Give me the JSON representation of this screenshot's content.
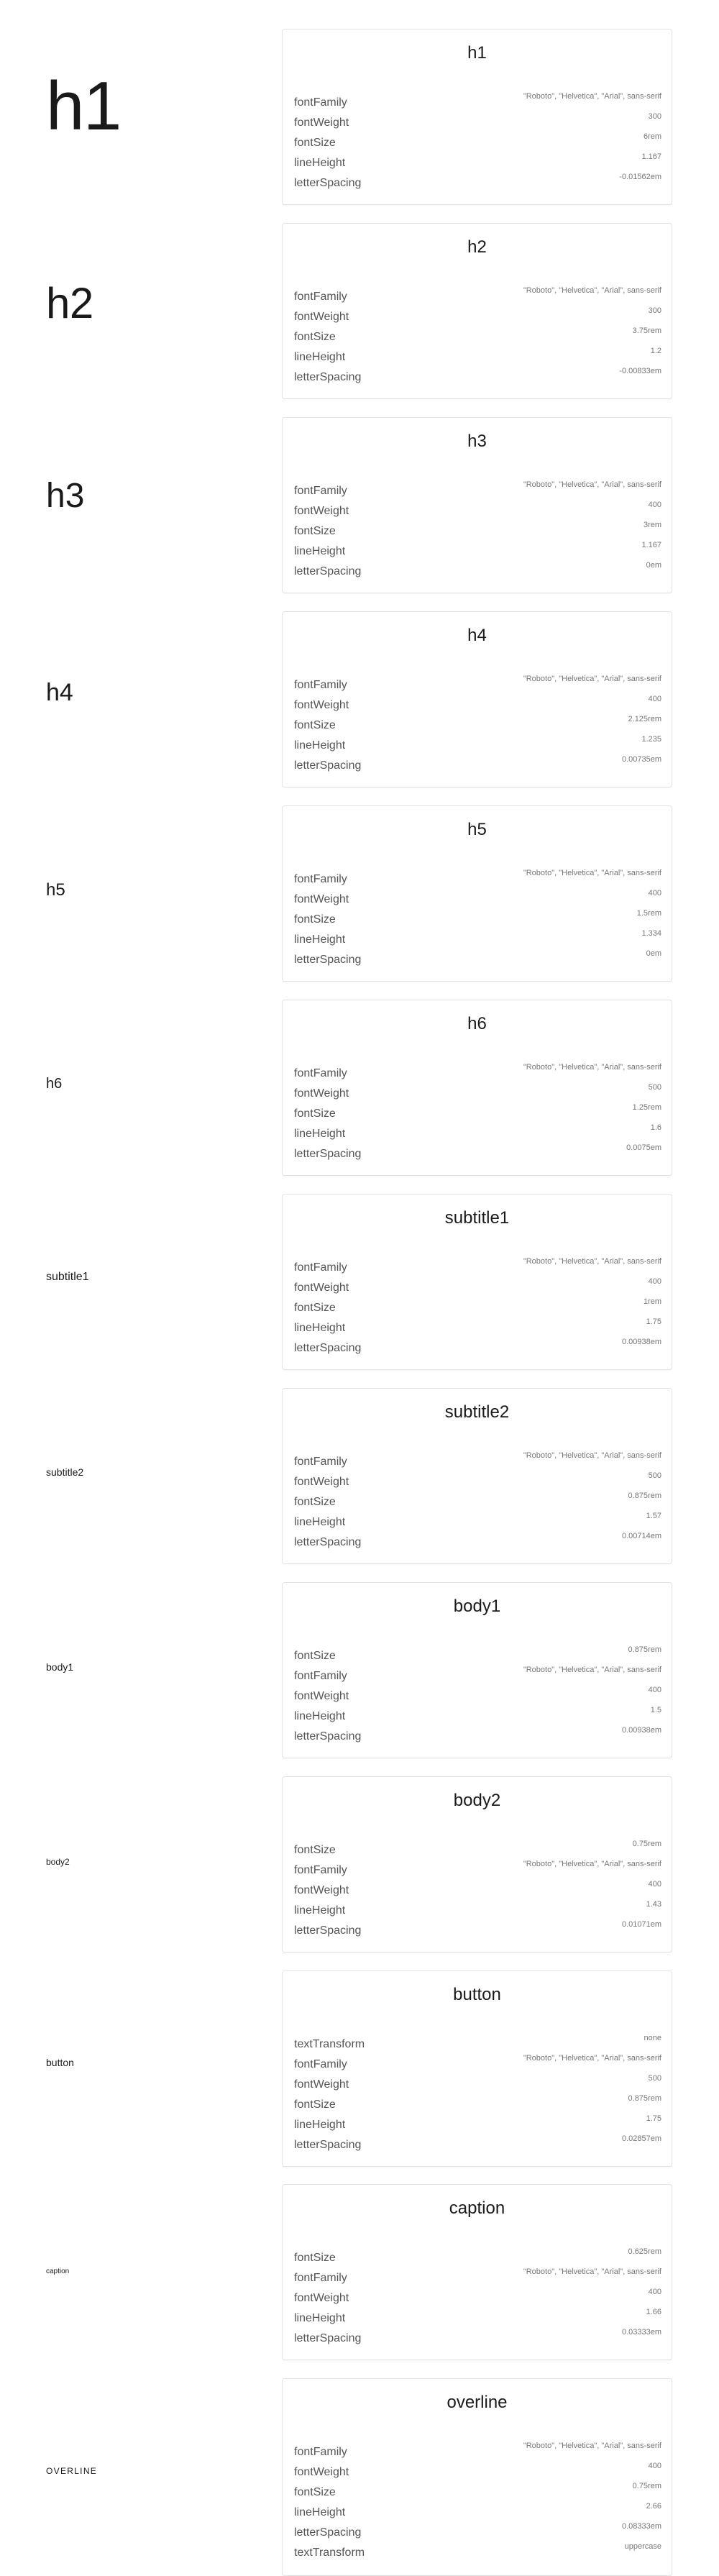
{
  "variants": [
    {
      "key": "h1",
      "sample": "h1",
      "title": "h1",
      "props": [
        {
          "k": "fontFamily",
          "v": "\"Roboto\", \"Helvetica\", \"Arial\", sans-serif"
        },
        {
          "k": "fontWeight",
          "v": "300"
        },
        {
          "k": "fontSize",
          "v": "6rem"
        },
        {
          "k": "lineHeight",
          "v": "1.167"
        },
        {
          "k": "letterSpacing",
          "v": "-0.01562em"
        }
      ]
    },
    {
      "key": "h2",
      "sample": "h2",
      "title": "h2",
      "props": [
        {
          "k": "fontFamily",
          "v": "\"Roboto\", \"Helvetica\", \"Arial\", sans-serif"
        },
        {
          "k": "fontWeight",
          "v": "300"
        },
        {
          "k": "fontSize",
          "v": "3.75rem"
        },
        {
          "k": "lineHeight",
          "v": "1.2"
        },
        {
          "k": "letterSpacing",
          "v": "-0.00833em"
        }
      ]
    },
    {
      "key": "h3",
      "sample": "h3",
      "title": "h3",
      "props": [
        {
          "k": "fontFamily",
          "v": "\"Roboto\", \"Helvetica\", \"Arial\", sans-serif"
        },
        {
          "k": "fontWeight",
          "v": "400"
        },
        {
          "k": "fontSize",
          "v": "3rem"
        },
        {
          "k": "lineHeight",
          "v": "1.167"
        },
        {
          "k": "letterSpacing",
          "v": "0em"
        }
      ]
    },
    {
      "key": "h4",
      "sample": "h4",
      "title": "h4",
      "props": [
        {
          "k": "fontFamily",
          "v": "\"Roboto\", \"Helvetica\", \"Arial\", sans-serif"
        },
        {
          "k": "fontWeight",
          "v": "400"
        },
        {
          "k": "fontSize",
          "v": "2.125rem"
        },
        {
          "k": "lineHeight",
          "v": "1.235"
        },
        {
          "k": "letterSpacing",
          "v": "0.00735em"
        }
      ]
    },
    {
      "key": "h5",
      "sample": "h5",
      "title": "h5",
      "props": [
        {
          "k": "fontFamily",
          "v": "\"Roboto\", \"Helvetica\", \"Arial\", sans-serif"
        },
        {
          "k": "fontWeight",
          "v": "400"
        },
        {
          "k": "fontSize",
          "v": "1.5rem"
        },
        {
          "k": "lineHeight",
          "v": "1.334"
        },
        {
          "k": "letterSpacing",
          "v": "0em"
        }
      ]
    },
    {
      "key": "h6",
      "sample": "h6",
      "title": "h6",
      "props": [
        {
          "k": "fontFamily",
          "v": "\"Roboto\", \"Helvetica\", \"Arial\", sans-serif"
        },
        {
          "k": "fontWeight",
          "v": "500"
        },
        {
          "k": "fontSize",
          "v": "1.25rem"
        },
        {
          "k": "lineHeight",
          "v": "1.6"
        },
        {
          "k": "letterSpacing",
          "v": "0.0075em"
        }
      ]
    },
    {
      "key": "subtitle1",
      "sample": "subtitle1",
      "title": "subtitle1",
      "props": [
        {
          "k": "fontFamily",
          "v": "\"Roboto\", \"Helvetica\", \"Arial\", sans-serif"
        },
        {
          "k": "fontWeight",
          "v": "400"
        },
        {
          "k": "fontSize",
          "v": "1rem"
        },
        {
          "k": "lineHeight",
          "v": "1.75"
        },
        {
          "k": "letterSpacing",
          "v": "0.00938em"
        }
      ]
    },
    {
      "key": "subtitle2",
      "sample": "subtitle2",
      "title": "subtitle2",
      "props": [
        {
          "k": "fontFamily",
          "v": "\"Roboto\", \"Helvetica\", \"Arial\", sans-serif"
        },
        {
          "k": "fontWeight",
          "v": "500"
        },
        {
          "k": "fontSize",
          "v": "0.875rem"
        },
        {
          "k": "lineHeight",
          "v": "1.57"
        },
        {
          "k": "letterSpacing",
          "v": "0.00714em"
        }
      ]
    },
    {
      "key": "body1",
      "sample": "body1",
      "title": "body1",
      "props": [
        {
          "k": "fontSize",
          "v": "0.875rem"
        },
        {
          "k": "fontFamily",
          "v": "\"Roboto\", \"Helvetica\", \"Arial\", sans-serif"
        },
        {
          "k": "fontWeight",
          "v": "400"
        },
        {
          "k": "lineHeight",
          "v": "1.5"
        },
        {
          "k": "letterSpacing",
          "v": "0.00938em"
        }
      ]
    },
    {
      "key": "body2",
      "sample": "body2",
      "title": "body2",
      "props": [
        {
          "k": "fontSize",
          "v": "0.75rem"
        },
        {
          "k": "fontFamily",
          "v": "\"Roboto\", \"Helvetica\", \"Arial\", sans-serif"
        },
        {
          "k": "fontWeight",
          "v": "400"
        },
        {
          "k": "lineHeight",
          "v": "1.43"
        },
        {
          "k": "letterSpacing",
          "v": "0.01071em"
        }
      ]
    },
    {
      "key": "button",
      "sample": "button",
      "title": "button",
      "props": [
        {
          "k": "textTransform",
          "v": "none"
        },
        {
          "k": "fontFamily",
          "v": "\"Roboto\", \"Helvetica\", \"Arial\", sans-serif"
        },
        {
          "k": "fontWeight",
          "v": "500"
        },
        {
          "k": "fontSize",
          "v": "0.875rem"
        },
        {
          "k": "lineHeight",
          "v": "1.75"
        },
        {
          "k": "letterSpacing",
          "v": "0.02857em"
        }
      ]
    },
    {
      "key": "caption",
      "sample": "caption",
      "title": "caption",
      "props": [
        {
          "k": "fontSize",
          "v": "0.625rem"
        },
        {
          "k": "fontFamily",
          "v": "\"Roboto\", \"Helvetica\", \"Arial\", sans-serif"
        },
        {
          "k": "fontWeight",
          "v": "400"
        },
        {
          "k": "lineHeight",
          "v": "1.66"
        },
        {
          "k": "letterSpacing",
          "v": "0.03333em"
        }
      ]
    },
    {
      "key": "overline",
      "sample": "OVERLINE",
      "title": "overline",
      "props": [
        {
          "k": "fontFamily",
          "v": "\"Roboto\", \"Helvetica\", \"Arial\", sans-serif"
        },
        {
          "k": "fontWeight",
          "v": "400"
        },
        {
          "k": "fontSize",
          "v": "0.75rem"
        },
        {
          "k": "lineHeight",
          "v": "2.66"
        },
        {
          "k": "letterSpacing",
          "v": "0.08333em"
        },
        {
          "k": "textTransform",
          "v": "uppercase"
        }
      ]
    }
  ]
}
